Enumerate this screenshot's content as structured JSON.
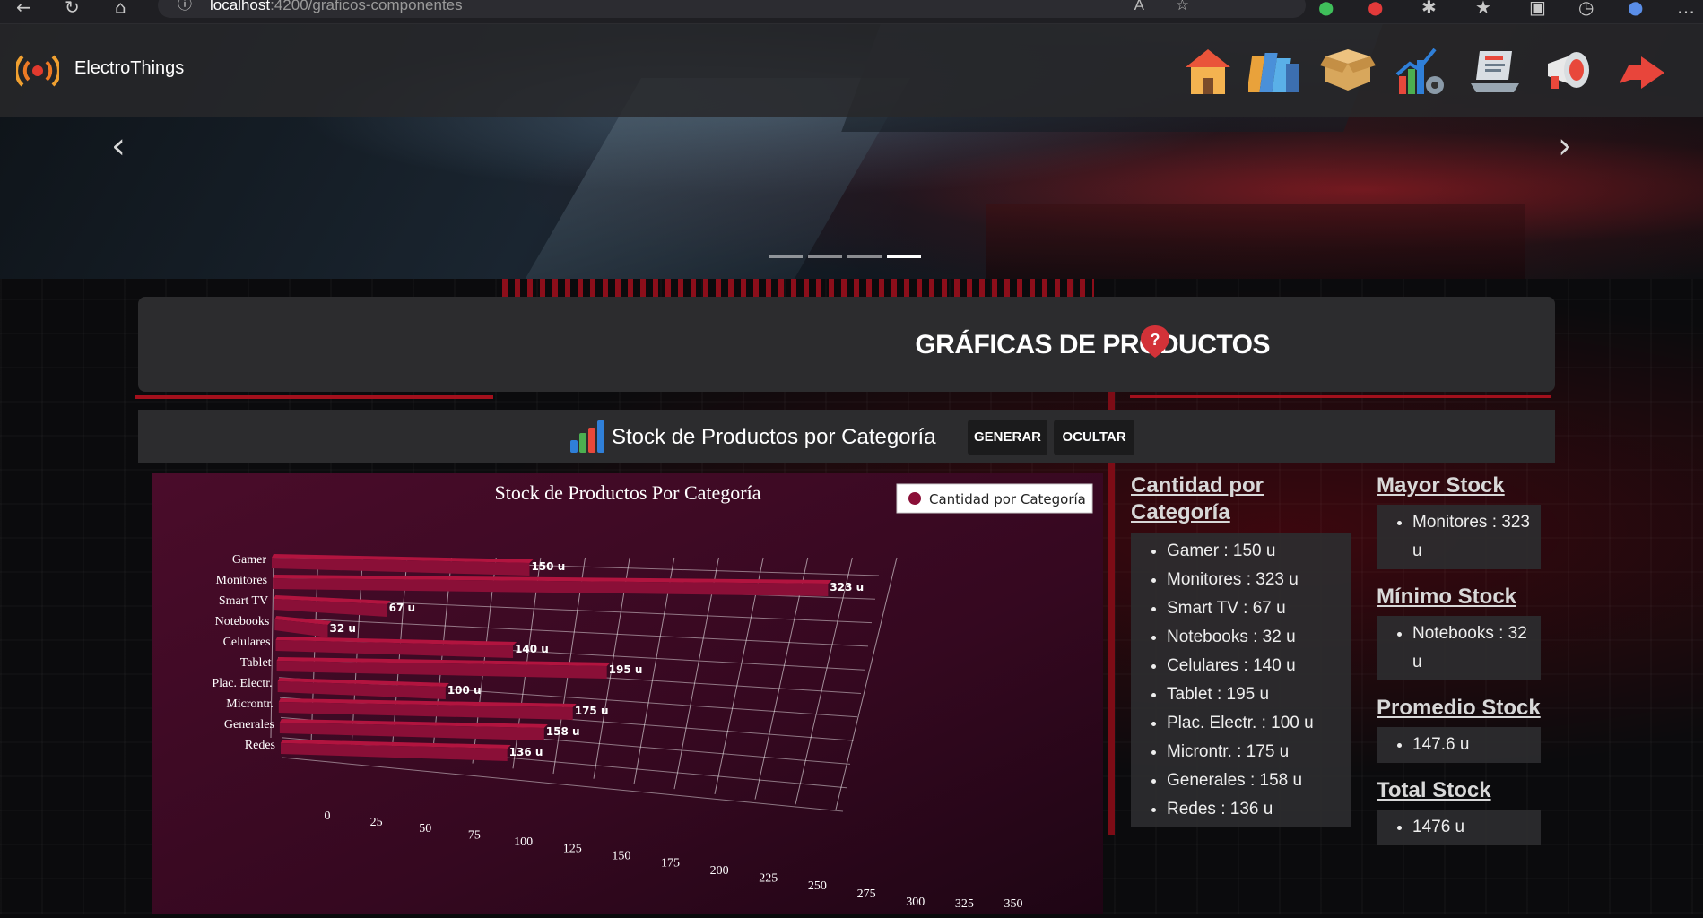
{
  "browser": {
    "url_host": "localhost",
    "url_rest": ":4200/graficos-componentes"
  },
  "brand": {
    "name": "ElectroThings"
  },
  "nav_icons": [
    "home-icon",
    "catalog-books-icon",
    "open-box-icon",
    "chart-gear-icon",
    "laptop-list-icon",
    "megaphone-icon",
    "logout-icon"
  ],
  "page_title": "GRÁFICAS DE PRODUCTOS",
  "section": {
    "title": "Stock de Productos por Categoría",
    "generar_label": "GENERAR",
    "ocultar_label": "OCULTAR"
  },
  "colors": {
    "bar": "#8a0f37",
    "bar_top": "#b2143f",
    "chart_bg": "#3f0a22",
    "accent_red": "#d33238",
    "panel": "#2c2c2e"
  },
  "chart_data": {
    "type": "bar",
    "orientation": "horizontal",
    "title": "Stock de Productos Por Categoría",
    "legend": "Cantidad por Categoría",
    "legend_position": "top-right",
    "categories": [
      "Gamer",
      "Monitores",
      "Smart TV",
      "Notebooks",
      "Celulares",
      "Tablet",
      "Plac. Electr.",
      "Microntr.",
      "Generales",
      "Redes"
    ],
    "values": [
      150,
      323,
      67,
      32,
      140,
      195,
      100,
      175,
      158,
      136
    ],
    "data_labels": [
      "150 u",
      "323 u",
      "67 u",
      "32 u",
      "140 u",
      "195 u",
      "100 u",
      "175 u",
      "158 u",
      "136 u"
    ],
    "xlim": [
      0,
      350
    ],
    "xticks": [
      "0",
      "25",
      "50",
      "75",
      "100",
      "125",
      "150",
      "175",
      "200",
      "225",
      "250",
      "275",
      "300",
      "325",
      "350"
    ],
    "grid": true
  },
  "cantidad": {
    "heading": "Cantidad por Categoría",
    "items": [
      "Gamer : 150 u",
      "Monitores : 323 u",
      "Smart TV : 67 u",
      "Notebooks : 32 u",
      "Celulares : 140 u",
      "Tablet : 195 u",
      "Plac. Electr. : 100 u",
      "Microntr. : 175 u",
      "Generales : 158 u",
      "Redes : 136 u"
    ]
  },
  "mayor": {
    "heading": "Mayor Stock",
    "item": "Monitores : 323 u"
  },
  "minimo": {
    "heading": "Mínimo Stock",
    "item": "Notebooks : 32 u"
  },
  "promedio": {
    "heading": "Promedio Stock",
    "item": "147.6 u"
  },
  "total": {
    "heading": "Total Stock",
    "item": "1476 u"
  }
}
